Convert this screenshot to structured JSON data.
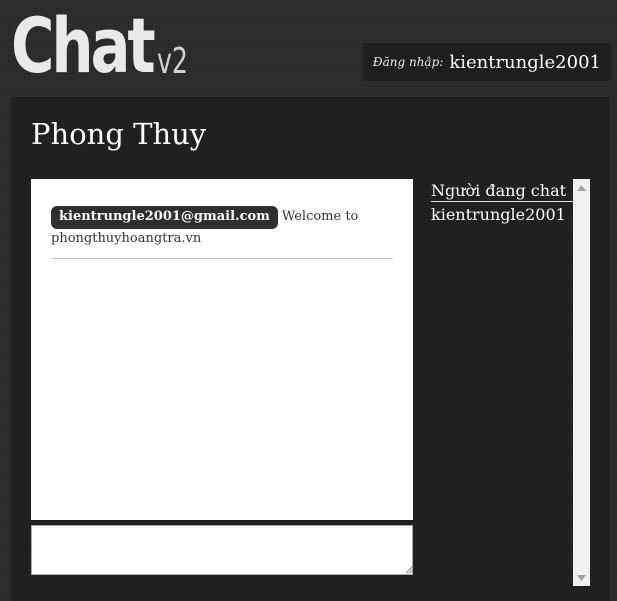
{
  "header": {
    "logo_word": "Chat",
    "logo_version": "v2",
    "login_label": "Đăng nhập:",
    "login_user": "kientrungle2001"
  },
  "room": {
    "title": "Phong Thuy"
  },
  "messages": [
    {
      "sender": "kientrungle2001@gmail.com",
      "text": "Welcome to phongthuyhoangtra.vn"
    }
  ],
  "composer": {
    "value": "",
    "placeholder": ""
  },
  "online_users": {
    "heading": "Người đang chat",
    "users": [
      "kientrungle2001"
    ]
  },
  "icons": {
    "scroll_up": "triangle-up-icon",
    "scroll_down": "triangle-down-icon",
    "resize_grip": "resize-grip-icon"
  },
  "colors": {
    "page_bg": "#2b2b2b",
    "panel_bg": "#1f1f1f",
    "sender_badge": "#2f2f2f",
    "text_light": "#ffffff"
  }
}
